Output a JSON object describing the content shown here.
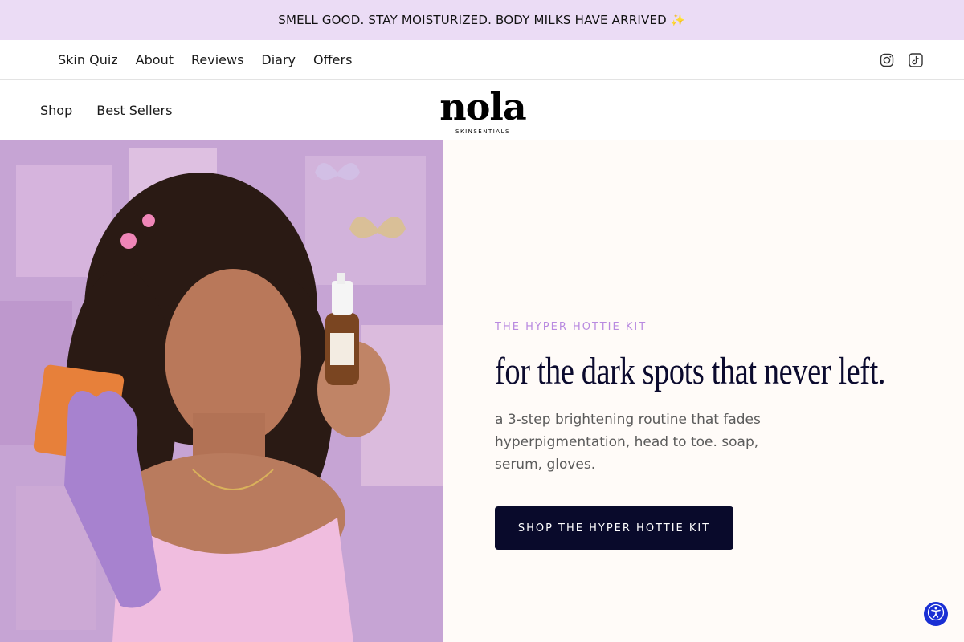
{
  "announcement": {
    "text": "SMELL GOOD. STAY MOISTURIZED. BODY MILKS HAVE ARRIVED ✨"
  },
  "utility_nav": {
    "items": [
      {
        "label": "Skin Quiz"
      },
      {
        "label": "About"
      },
      {
        "label": "Reviews"
      },
      {
        "label": "Diary"
      },
      {
        "label": "Offers"
      }
    ],
    "social": [
      "instagram-icon",
      "tiktok-icon"
    ]
  },
  "main_nav": {
    "items": [
      {
        "label": "Shop"
      },
      {
        "label": "Best Sellers"
      }
    ]
  },
  "logo": {
    "word": "nola",
    "subtitle": "SKINSENTIALS"
  },
  "hero": {
    "eyebrow": "THE HYPER HOTTIE KIT",
    "headline": "for the dark spots that never left.",
    "subcopy": "a 3-step brightening routine that fades hyperpigmentation, head to toe. soap, serum, gloves.",
    "cta_label": "SHOP THE HYPER HOTTIE KIT",
    "image_alt": "Model holding an orange soap bar, purple exfoliating glove, and serum bottle"
  },
  "colors": {
    "announcement_bg": "#ebdcf5",
    "eyebrow": "#b98ae0",
    "headline": "#0b0a2e",
    "cta_bg": "#090a2b",
    "accessibility_button": "#1a2fd4"
  },
  "accessibility": {
    "icon": "accessibility-icon"
  }
}
